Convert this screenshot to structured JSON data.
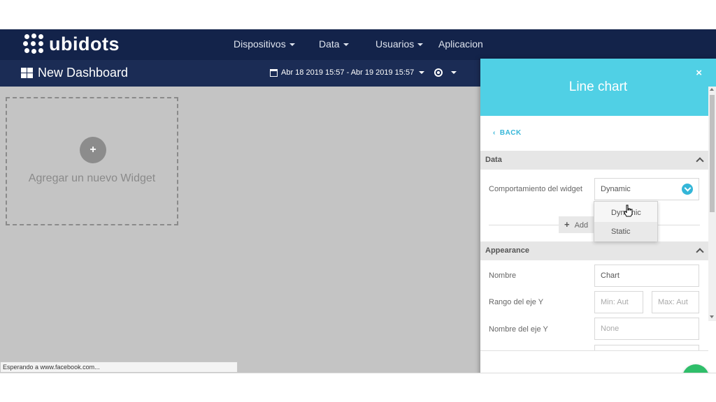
{
  "app": {
    "logo_text": "ubidots",
    "nav": [
      {
        "label": "Dispositivos"
      },
      {
        "label": "Data"
      },
      {
        "label": "Usuarios"
      },
      {
        "label": "Aplicacion"
      }
    ],
    "dashboard_title": "New Dashboard",
    "date_range": "Abr 18 2019 15:57 - Abr 19 2019 15:57"
  },
  "canvas": {
    "add_widget_symbol": "+",
    "add_widget_label": "Agregar un nuevo Widget"
  },
  "status_bar": {
    "text": "Esperando a www.facebook.com..."
  },
  "panel": {
    "title": "Line chart",
    "close_symbol": "×",
    "back_label": "BACK",
    "data_section": {
      "title": "Data",
      "behavior_label": "Comportamiento del widget",
      "behavior_value": "Dynamic",
      "add_variable_prefix": "+",
      "add_variable_label": "Add",
      "dropdown_options": [
        "Dynamic",
        "Static"
      ],
      "hovered_option": "Static"
    },
    "appearance_section": {
      "title": "Appearance",
      "name_label": "Nombre",
      "name_value": "Chart",
      "y_range_label": "Rango del eje Y",
      "y_min_placeholder": "Min: Aut",
      "y_max_placeholder": "Max: Aut",
      "y_axis_name_label": "Nombre del eje Y",
      "y_axis_name_value": "None"
    }
  },
  "colors": {
    "nav_bg": "#13234a",
    "panel_header": "#50d0e5",
    "accent": "#34b6d8",
    "save_button": "#2fbe6a",
    "canvas_bg": "#c4c4c4"
  }
}
